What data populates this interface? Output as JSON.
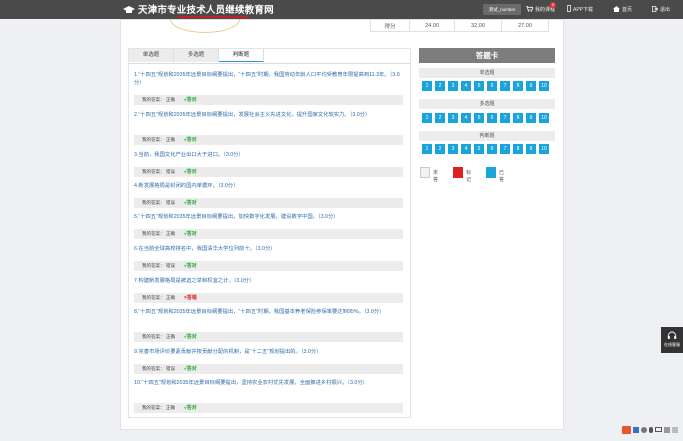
{
  "header": {
    "logo_text": "天津市专业技术人员继续教育网",
    "user_label": "测试_number",
    "nav": [
      {
        "label": "我的课程",
        "icon": "cart-icon"
      },
      {
        "label": "APP下载",
        "icon": "phone-icon"
      },
      {
        "label": "首页",
        "icon": "home-icon"
      },
      {
        "label": "退出",
        "icon": "logout-icon"
      }
    ],
    "cart_badge": "0"
  },
  "score_table": {
    "label": "得分",
    "values": [
      "24.00",
      "32.00",
      "27.00"
    ]
  },
  "tabs": [
    "单选题",
    "多选题",
    "判断题"
  ],
  "answer_prefix": "我的答案：",
  "questions": [
    {
      "text": "1.“十四五”规划和2035年远景目标纲要提出，“十四五”时期，我国劳动年龄人口平均受教育年限提高到11.3年。（3.0分）",
      "answer": "正确",
      "result": "√答对",
      "ok": true
    },
    {
      "text": "2.“十四五”规划和2035年远景目标纲要提出，发展社会主义先进文化，提升国家文化软实力。（3.0分）",
      "answer": "正确",
      "result": "√答对",
      "ok": true
    },
    {
      "text": "3.当前，我国文化产业出口大于进口。（3.0分）",
      "answer": "错误",
      "result": "√答对",
      "ok": true
    },
    {
      "text": "4.新发展格局是封闭的国内单循环。（3.0分）",
      "answer": "错误",
      "result": "√答对",
      "ok": true
    },
    {
      "text": "5.“十四五”规划和2035年远景目标纲要提出，加快数字化发展，建设数字中国。（3.0分）",
      "answer": "正确",
      "result": "√答对",
      "ok": true
    },
    {
      "text": "6.在当前全球高校排名中，我国清华大学位列前十。（3.0分）",
      "answer": "错误",
      "result": "√答对",
      "ok": true
    },
    {
      "text": "7.构建新发展格局是被迫之举和权宜之计。（3.0分）",
      "answer": "正确",
      "result": "×答错",
      "ok": false
    },
    {
      "text": "8.“十四五”规划和2035年远景目标纲要提出，“十四五”时期，我国基本养老保险参保率要达到95%。（3.0分）",
      "answer": "正确",
      "result": "√答对",
      "ok": true
    },
    {
      "text": "9.完善市场评价要素贡献并按贡献分配的机制，是“十二五”规划提出的。（3.0分）",
      "answer": "错误",
      "result": "√答对",
      "ok": true
    },
    {
      "text": "10.“十四五”规划和2035年远景目标纲要提出，坚持农业农村优先发展，全面推进乡村振兴。（3.0分）",
      "answer": "正确",
      "result": "√答对",
      "ok": true
    }
  ],
  "answer_card": {
    "title": "答题卡",
    "sections": [
      {
        "name": "单选题",
        "numbers": [
          "1",
          "2",
          "3",
          "4",
          "5",
          "6",
          "7",
          "8",
          "9",
          "10"
        ]
      },
      {
        "name": "多选题",
        "numbers": [
          "1",
          "2",
          "3",
          "4",
          "5",
          "6",
          "7",
          "8",
          "9",
          "10"
        ]
      },
      {
        "name": "判断题",
        "numbers": [
          "1",
          "2",
          "3",
          "4",
          "5",
          "6",
          "7",
          "8",
          "9",
          "10"
        ]
      }
    ],
    "legend": [
      {
        "label": "未答",
        "color": "#f2f2f2"
      },
      {
        "label": "标记",
        "color": "#e02020"
      },
      {
        "label": "已答",
        "color": "#1ba4dc"
      }
    ]
  },
  "feedback_label": "在线客服"
}
